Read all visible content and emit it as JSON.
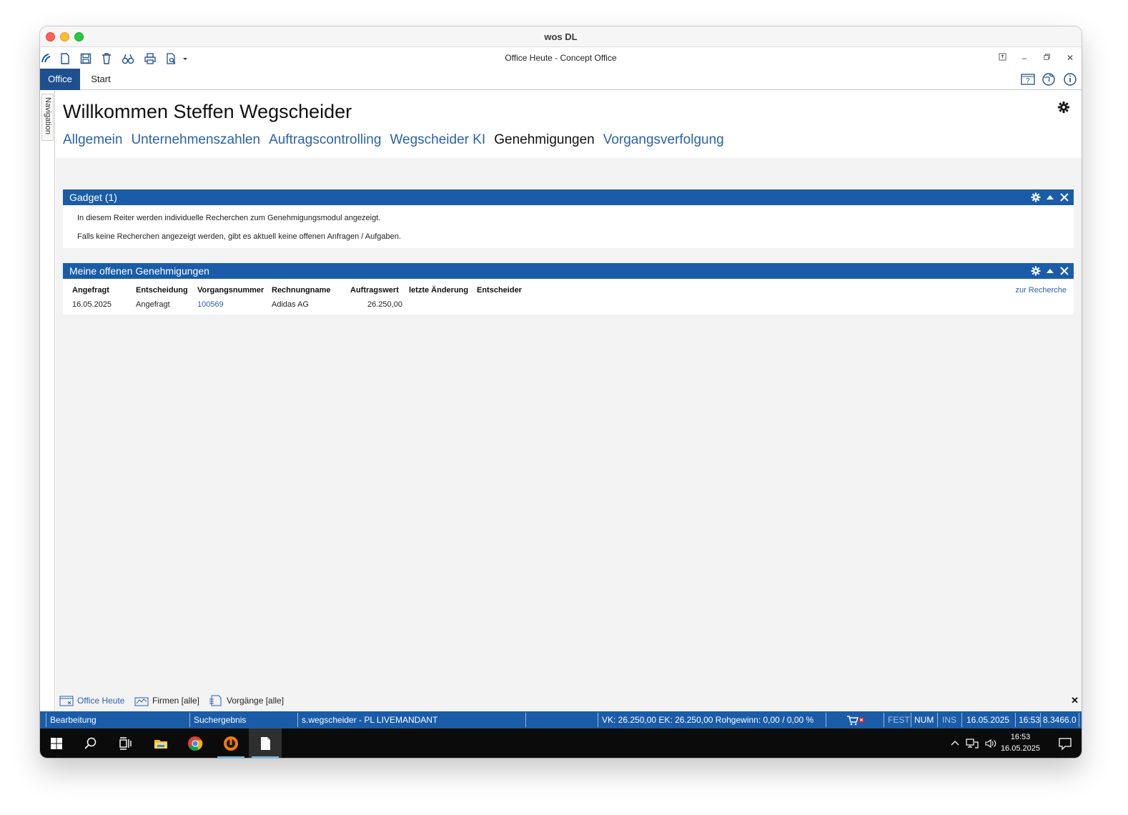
{
  "mac_window": {
    "title": "wos DL"
  },
  "app": {
    "title": "Office Heute - Concept Office"
  },
  "ribbon": {
    "tabs": [
      "Office",
      "Start"
    ]
  },
  "navigation": {
    "label": "Navigation"
  },
  "main": {
    "welcome": "Willkommen Steffen Wegscheider",
    "tabs": [
      "Allgemein",
      "Unternehmenszahlen",
      "Auftragscontrolling",
      "Wegscheider KI",
      "Genehmigungen",
      "Vorgangsverfolgung"
    ],
    "active_tab": "Genehmigungen"
  },
  "gadget1": {
    "title": "Gadget (1)",
    "lines": [
      "In diesem Reiter werden individuelle Recherchen zum Genehmigungsmodul angezeigt.",
      "Falls keine Recherchen angezeigt werden, gibt es aktuell keine offenen Anfragen / Aufgaben."
    ]
  },
  "gadget2": {
    "title": "Meine offenen Genehmigungen",
    "link": "zur Recherche",
    "columns": [
      "Angefragt",
      "Entscheidung",
      "Vorgangsnummer",
      "Rechnungname",
      "Auftragswert",
      "letzte Änderung",
      "Entscheider"
    ],
    "rows": [
      {
        "angefragt": "16.05.2025",
        "entscheidung": "Angefragt",
        "vorgangsnummer": "100569",
        "rechnungname": "Adidas AG",
        "auftragswert": "26.250,00",
        "letzte_aenderung": "",
        "entscheider": ""
      }
    ]
  },
  "bottom_tabs": [
    "Office Heute",
    "Firmen [alle]",
    "Vorgänge [alle]"
  ],
  "statusbar": {
    "mode": "Bearbeitung",
    "search": "Suchergebnis",
    "user": "s.wegscheider - PL LIVEMANDANT",
    "totals": "VK: 26.250,00 EK: 26.250,00 Rohgewinn: 0,00  / 0,00 %",
    "fest": "FEST",
    "num": "NUM",
    "ins": "INS",
    "date": "16.05.2025",
    "time": "16:53",
    "version": "8.3466.0"
  },
  "taskbar": {
    "time": "16:53",
    "date": "16.05.2025"
  },
  "colors": {
    "accent": "#1a5ca8",
    "ribbon_office": "#1e4f8f",
    "link": "#2a62a8"
  }
}
